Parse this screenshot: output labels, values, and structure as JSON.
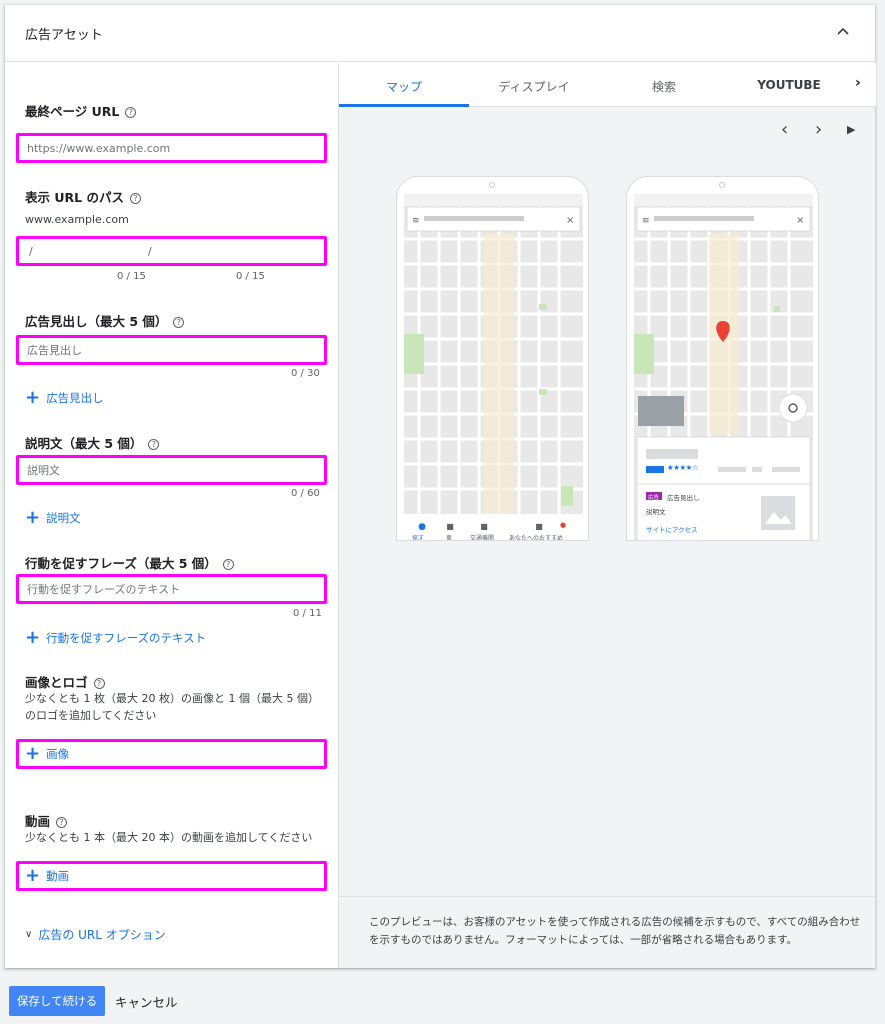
{
  "panel": {
    "title": "広告アセット"
  },
  "final_url": {
    "label": "最終ページ URL",
    "placeholder": "https://www.example.com"
  },
  "display_path": {
    "label": "表示 URL のパス",
    "domain": "www.example.com",
    "sep1": "/",
    "sep2": "/",
    "count1": "0 / 15",
    "count2": "0 / 15"
  },
  "headlines": {
    "label": "広告見出し（最大 5 個）",
    "placeholder": "広告見出し",
    "count": "0 / 30",
    "add_label": "広告見出し"
  },
  "descriptions": {
    "label": "説明文（最大 5 個）",
    "placeholder": "説明文",
    "count": "0 / 60",
    "add_label": "説明文"
  },
  "cta": {
    "label": "行動を促すフレーズ（最大 5 個）",
    "placeholder": "行動を促すフレーズのテキスト",
    "count": "0 / 11",
    "add_label": "行動を促すフレーズのテキスト"
  },
  "images": {
    "label": "画像とロゴ",
    "desc": "少なくとも 1 枚（最大 20 枚）の画像と 1 個（最大 5 個）のロゴを追加してください",
    "add_label": "画像"
  },
  "videos": {
    "label": "動画",
    "desc": "少なくとも 1 本（最大 20 本）の動画を追加してください",
    "add_label": "動画"
  },
  "url_options": {
    "label": "広告の URL オプション"
  },
  "preview": {
    "tabs": [
      "マップ",
      "ディスプレイ",
      "検索",
      "YOUTUBE"
    ],
    "active_tab": "マップ",
    "note": "このプレビューは、お客様のアセットを使って作成される広告の候補を示すもので、すべての組み合わせを示すものではありません。フォーマットによっては、一部が省略される場合もあります。",
    "phone1_nav": [
      "探す",
      "車",
      "交通機関",
      "あなたへのおすすめ"
    ],
    "ad_badge": "広告",
    "ad_headline": "広告見出し",
    "ad_desc": "説明文",
    "ad_link": "サイトにアクセス",
    "stars": "★★★★☆"
  },
  "footer": {
    "save_label": "保存して続ける",
    "cancel_label": "キャンセル"
  },
  "colors": {
    "accent": "#1a73e8",
    "highlight": "#ff00ff",
    "save_button": "#4285f4",
    "pin": "#ea4335"
  }
}
